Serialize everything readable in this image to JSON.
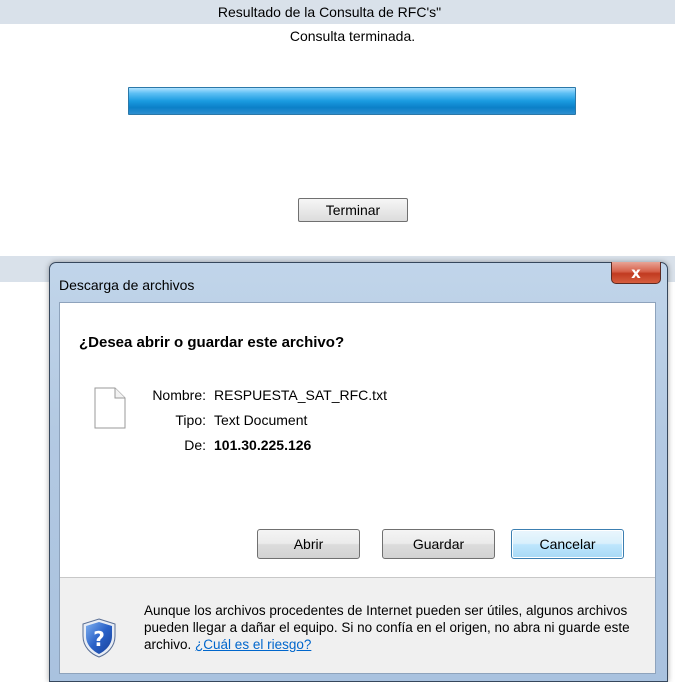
{
  "page": {
    "header_title": "Resultado de la Consulta de RFC's\"",
    "status": "Consulta terminada.",
    "progress": 1.0,
    "finish_button": "Terminar"
  },
  "dialog": {
    "title": "Descarga de archivos",
    "close_label": "x",
    "question": "¿Desea abrir o guardar este archivo?",
    "file": {
      "name_label": "Nombre:",
      "name_value": "RESPUESTA_SAT_RFC.txt",
      "type_label": "Tipo:",
      "type_value": "Text Document",
      "from_label": "De:",
      "from_value": "101.30.225.126"
    },
    "buttons": {
      "open": "Abrir",
      "save": "Guardar",
      "cancel": "Cancelar"
    },
    "warning": {
      "text": "Aunque los archivos procedentes de Internet pueden ser útiles, algunos archivos pueden llegar a dañar el equipo. Si no confía en el origen, no abra ni guarde este archivo.",
      "link": "¿Cuál es el riesgo?"
    },
    "icons": {
      "file": "file-icon",
      "shield": "shield-icon",
      "close": "close-icon"
    }
  }
}
